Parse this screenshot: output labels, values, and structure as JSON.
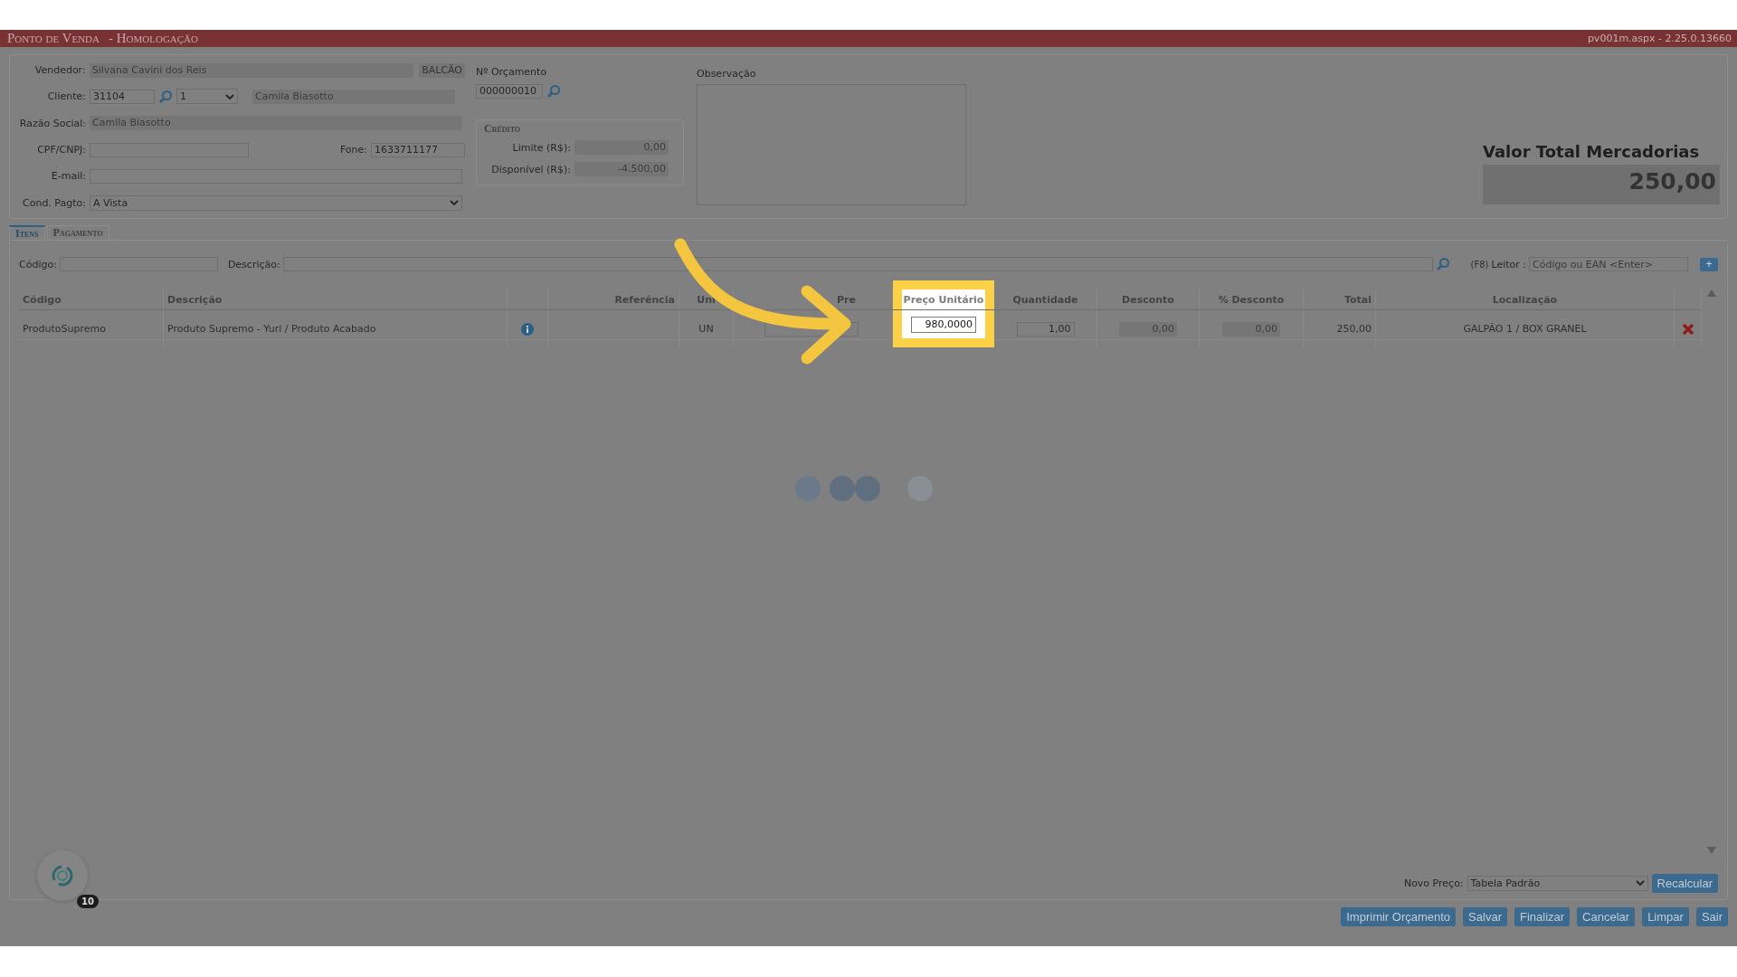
{
  "title_bar": {
    "title": "Ponto de Venda",
    "subtitle": "- Homologação",
    "version": "pv001m.aspx - 2.25.0.13660"
  },
  "header_form": {
    "vendedor": {
      "label": "Vendedor:",
      "value": "Silvana Cavini dos Reis",
      "tag": "BALCÃO"
    },
    "cliente": {
      "label": "Cliente:",
      "code": "31104",
      "select": "1",
      "name": "Camila Biasotto"
    },
    "razao_social": {
      "label": "Razão Social:",
      "value": "Camila Biasotto"
    },
    "cpf_cnpj": {
      "label": "CPF/CNPJ:"
    },
    "fone": {
      "label": "Fone:",
      "value": "1633711177"
    },
    "email": {
      "label": "E-mail:"
    },
    "cond_pagto": {
      "label": "Cond. Pagto:",
      "value": "A Vista"
    }
  },
  "orcamento": {
    "label": "Nº Orçamento",
    "value": "000000010"
  },
  "credito": {
    "title": "Crédito",
    "fields": [
      {
        "label": "Limite (R$):",
        "value": "0,00"
      },
      {
        "label": "Disponível (R$):",
        "value": "-4.500,00"
      }
    ]
  },
  "observacao": {
    "label": "Observação"
  },
  "total": {
    "label": "Valor Total Mercadorias",
    "value": "250,00"
  },
  "tabs": [
    {
      "label": "Itens",
      "selected": true
    },
    {
      "label": "Pagamento",
      "selected": false
    }
  ],
  "search": {
    "codigo_label": "Código:",
    "descricao_label": "Descrição:",
    "shortcut": "(F8)",
    "leitor_label": "Leitor :",
    "leitor_placeholder": "Código ou EAN <Enter>",
    "add_button": "+"
  },
  "table": {
    "columns": [
      "Código",
      "Descrição",
      "",
      "Referência",
      "Uni",
      "Pre",
      "Preço Unitário",
      "Quantidade",
      "Desconto",
      "% Desconto",
      "Total",
      "Localização"
    ],
    "rows": [
      {
        "codigo": "ProdutoSupremo",
        "descricao": "Produto Supremo - Yuri / Produto Acabado",
        "unidade": "UN",
        "preco_unitario": "980,0000",
        "quantidade": "1,00",
        "desconto": "0,00",
        "pct_desconto": "0,00",
        "total": "250,00",
        "localizacao": "GALPÃO 1 / BOX GRANEL"
      }
    ]
  },
  "novo_preco": {
    "label": "Novo Preço:",
    "value": "Tabela Padrão",
    "button": "Recalcular"
  },
  "badge": {
    "count": "10"
  },
  "buttons": [
    "Imprimir Orçamento",
    "Salvar",
    "Finalizar",
    "Cancelar",
    "Limpar",
    "Sair"
  ]
}
